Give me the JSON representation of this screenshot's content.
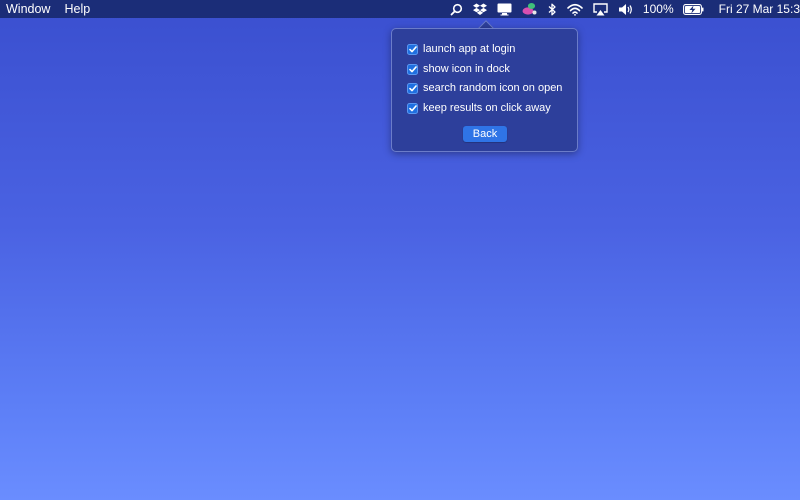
{
  "menubar": {
    "left_items": [
      "Window",
      "Help"
    ],
    "right_icons": [
      "search-icon",
      "dropbox-icon",
      "display-icon",
      "app-status-icon",
      "bluetooth-icon",
      "wifi-icon",
      "airplay-icon",
      "volume-icon"
    ],
    "battery_percent": "100%",
    "clock": "Fri 27 Mar  15:3"
  },
  "popover": {
    "options": [
      {
        "label": "launch app at login",
        "checked": true
      },
      {
        "label": "show icon in dock",
        "checked": true
      },
      {
        "label": "search random icon on open",
        "checked": true
      },
      {
        "label": "keep results on click away",
        "checked": true
      }
    ],
    "back_label": "Back"
  },
  "colors": {
    "menubar_bg": "#1b2d78",
    "popover_bg": "#2d3f9b",
    "checkbox_bg": "#1f6fe0",
    "button_bg": "#2f74e6",
    "desktop_top": "#3a4fcf",
    "desktop_bottom": "#6a8dff"
  }
}
